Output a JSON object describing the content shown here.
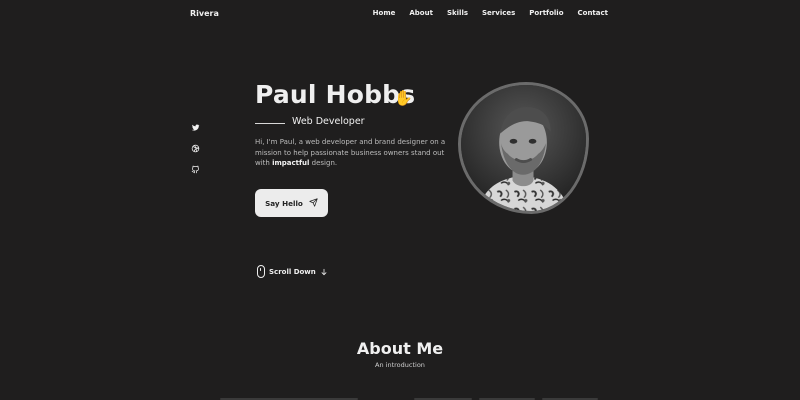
{
  "header": {
    "brand": "Rivera",
    "nav": [
      {
        "label": "Home"
      },
      {
        "label": "About"
      },
      {
        "label": "Skills"
      },
      {
        "label": "Services"
      },
      {
        "label": "Portfolio"
      },
      {
        "label": "Contact"
      }
    ]
  },
  "social": {
    "icons": [
      "twitter-icon",
      "dribbble-icon",
      "github-icon"
    ]
  },
  "hero": {
    "name": "Paul Hobbs",
    "wave_icon": "waving-hand-icon",
    "role": "Web Developer",
    "bio_pre": "Hi, I'm Paul, a web developer and brand designer on a mission to help passionate business owners stand out with ",
    "bio_strong": "impactful",
    "bio_post": " design.",
    "cta": "Say Hello",
    "scroll": "Scroll Down"
  },
  "about": {
    "title": "About Me",
    "subtitle": "An introduction"
  },
  "colors": {
    "background": "#1f1e1e",
    "text": "#efefef",
    "muted": "#bcbcbc",
    "button_bg": "#ececec",
    "wave": "#f4c54b"
  }
}
